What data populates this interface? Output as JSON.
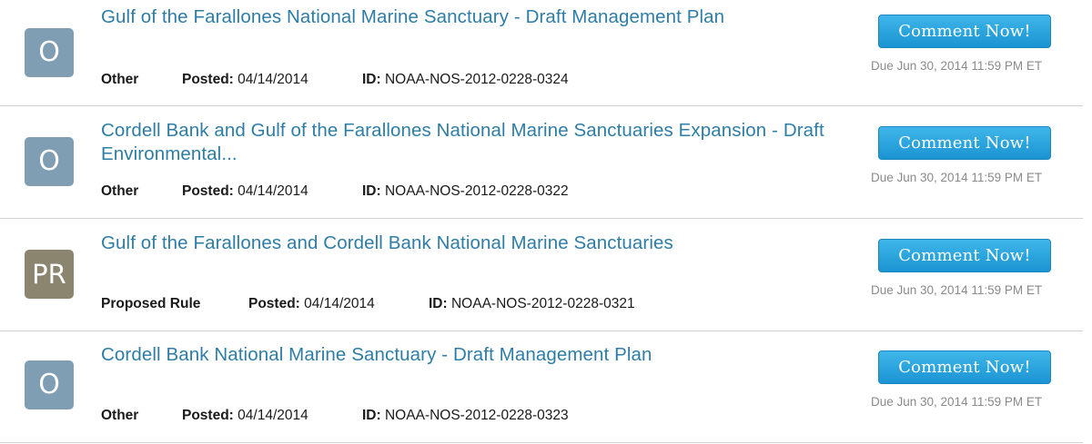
{
  "documents": [
    {
      "type_badge": "O",
      "title": "Gulf of the Farallones National Marine Sanctuary - Draft Management Plan",
      "doc_type": "Other",
      "posted_label": "Posted:",
      "posted_date": "04/14/2014",
      "id_label": "ID:",
      "id": "NOAA-NOS-2012-0228-0324",
      "button_label": "Comment Now!",
      "due": "Due Jun 30, 2014 11:59 PM ET"
    },
    {
      "type_badge": "O",
      "title": "Cordell Bank and Gulf of the Farallones National Marine Sanctuaries Expansion - Draft Environmental...",
      "doc_type": "Other",
      "posted_label": "Posted:",
      "posted_date": "04/14/2014",
      "id_label": "ID:",
      "id": "NOAA-NOS-2012-0228-0322",
      "button_label": "Comment Now!",
      "due": "Due Jun 30, 2014 11:59 PM ET"
    },
    {
      "type_badge": "PR",
      "title": "Gulf of the Farallones and Cordell Bank National Marine Sanctuaries",
      "doc_type": "Proposed Rule",
      "posted_label": "Posted:",
      "posted_date": "04/14/2014",
      "id_label": "ID:",
      "id": "NOAA-NOS-2012-0228-0321",
      "button_label": "Comment Now!",
      "due": "Due Jun 30, 2014 11:59 PM ET"
    },
    {
      "type_badge": "O",
      "title": "Cordell Bank National Marine Sanctuary - Draft Management Plan",
      "doc_type": "Other",
      "posted_label": "Posted:",
      "posted_date": "04/14/2014",
      "id_label": "ID:",
      "id": "NOAA-NOS-2012-0228-0323",
      "button_label": "Comment Now!",
      "due": "Due Jun 30, 2014 11:59 PM ET"
    }
  ],
  "colors": {
    "title_link": "#2e7da6",
    "badge_other": "#7f9db3",
    "badge_proposed_rule": "#8b856f",
    "button": "#2aa6e0",
    "due_text": "#8a8a8a"
  }
}
